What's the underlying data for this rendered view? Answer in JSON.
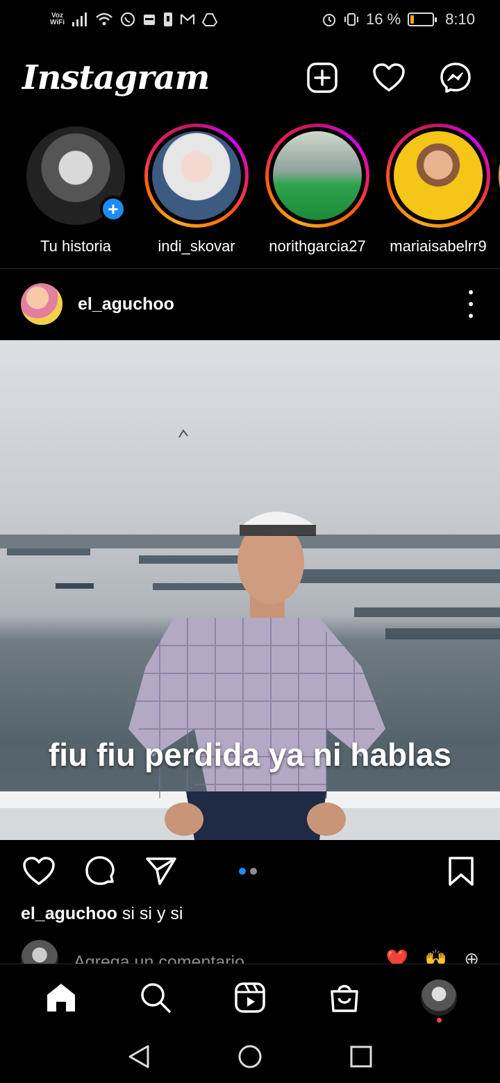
{
  "status_bar": {
    "carrier_label": "Voz\nWiFi",
    "battery_percent": "16 %",
    "battery_level": 0.16,
    "time": "8:10",
    "icons": [
      "signal-icon",
      "wifi-icon",
      "whatsapp-icon",
      "calendar-icon",
      "sim-icon",
      "gmail-icon",
      "drive-icon",
      "alarm-icon",
      "vibrate-icon",
      "battery-icon"
    ]
  },
  "header": {
    "logo": "Instagram",
    "icons": [
      "new-post-icon",
      "heart-icon",
      "messenger-icon"
    ]
  },
  "stories": [
    {
      "username": "Tu historia",
      "own": true
    },
    {
      "username": "indi_skovar"
    },
    {
      "username": "norithgarcia27"
    },
    {
      "username": "mariaisabelrr9"
    }
  ],
  "post": {
    "username": "el_aguchoo",
    "media_caption": "fiu fiu perdida ya ni hablas",
    "carousel": {
      "total": 2,
      "current": 1
    },
    "caption_username": "el_aguchoo",
    "caption_text": "si si y si",
    "comment_placeholder": "Agrega un comentario...",
    "quick_emojis": [
      "❤️",
      "🙌",
      "⊕"
    ]
  },
  "bottom_nav": {
    "items": [
      "home-icon",
      "search-icon",
      "reels-icon",
      "shop-icon",
      "profile-avatar"
    ]
  },
  "system_nav": [
    "back-icon",
    "home-circle-icon",
    "recents-icon"
  ]
}
